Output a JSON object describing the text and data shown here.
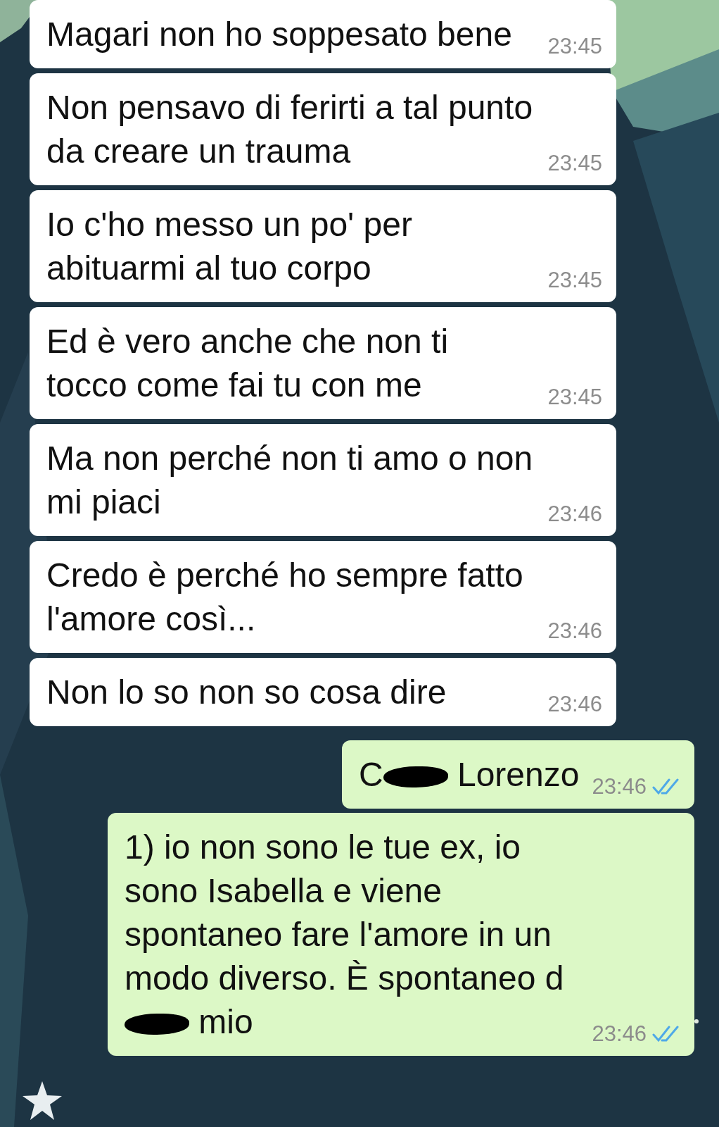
{
  "messages": [
    {
      "kind": "incoming",
      "parts": [
        {
          "kind": "text",
          "text": "Magari non ho soppesato bene"
        }
      ],
      "time": "23:45"
    },
    {
      "kind": "incoming",
      "parts": [
        {
          "kind": "text",
          "text": "Non pensavo di ferirti a tal punto da creare un trauma"
        }
      ],
      "time": "23:45"
    },
    {
      "kind": "incoming",
      "parts": [
        {
          "kind": "text",
          "text": "Io c'ho messo un po' per abituarmi al tuo corpo"
        }
      ],
      "time": "23:45"
    },
    {
      "kind": "incoming",
      "parts": [
        {
          "kind": "text",
          "text": "Ed è vero anche che non ti tocco come fai tu con me"
        }
      ],
      "time": "23:45"
    },
    {
      "kind": "incoming",
      "parts": [
        {
          "kind": "text",
          "text": "Ma non perché non ti amo o non mi piaci"
        }
      ],
      "time": "23:46"
    },
    {
      "kind": "incoming",
      "parts": [
        {
          "kind": "text",
          "text": "Credo è perché ho sempre fatto l'amore così..."
        }
      ],
      "time": "23:46"
    },
    {
      "kind": "incoming",
      "parts": [
        {
          "kind": "text",
          "text": "Non lo so non so cosa dire"
        }
      ],
      "time": "23:46"
    },
    {
      "kind": "outgoing",
      "parts": [
        {
          "kind": "text",
          "text": "C"
        },
        {
          "kind": "redaction"
        },
        {
          "kind": "text",
          "text": " Lorenzo"
        }
      ],
      "time": "23:46",
      "read": true
    },
    {
      "kind": "outgoing",
      "parts": [
        {
          "kind": "text",
          "text": "1) io non sono le tue ex, io sono Isabella e viene spontaneo fare l'amore in un modo diverso. È spontaneo d"
        },
        {
          "kind": "redaction"
        },
        {
          "kind": "text",
          "text": " mio"
        }
      ],
      "time": "23:46",
      "read": true
    }
  ]
}
